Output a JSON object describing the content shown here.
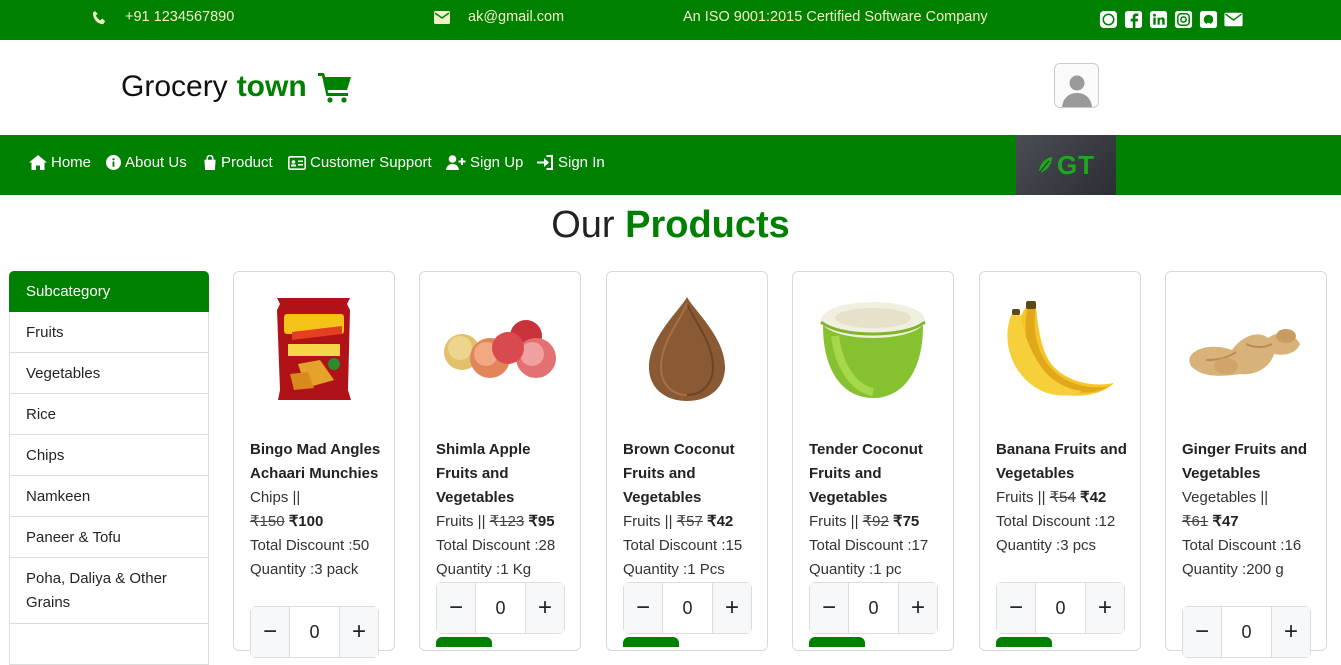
{
  "topbar": {
    "phone": "+91 1234567890",
    "email": "ak@gmail.com",
    "tagline": "An ISO 9001:2015 Certified Software Company",
    "social_icons": [
      "whatsapp-icon",
      "facebook-icon",
      "linkedin-icon",
      "instagram-icon",
      "github-icon",
      "mail-icon"
    ]
  },
  "brand": {
    "part1": "Grocery",
    "part2": "town",
    "accent": "#008000"
  },
  "nav": {
    "home": "Home",
    "about": "About Us",
    "product": "Product",
    "support": "Customer Support",
    "signup": "Sign Up",
    "signin": "Sign In",
    "logo_text": "GT"
  },
  "page": {
    "title_part1": "Our",
    "title_part2": "Products"
  },
  "sidebar": {
    "heading": "Subcategory",
    "items": [
      "Fruits",
      "Vegetables",
      "Rice",
      "Chips",
      "Namkeen",
      "Paneer & Tofu",
      "Poha, Daliya & Other Grains"
    ]
  },
  "products": [
    {
      "name": "Bingo Mad Angles Achaari Munchies",
      "category": "Chips ||",
      "mrp": "₹150",
      "price": "₹100",
      "discount": "Total Discount :50",
      "quantity": "Quantity :3 pack",
      "qty": "0"
    },
    {
      "name": "Shimla Apple Fruits and Vegetables",
      "category": "Fruits ||",
      "mrp": "₹123",
      "price": "₹95",
      "discount": "Total Discount :28",
      "quantity": "Quantity :1 Kg",
      "qty": "0"
    },
    {
      "name": "Brown Coconut Fruits and Vegetables",
      "category": "Fruits ||",
      "mrp": "₹57",
      "price": "₹42",
      "discount": "Total Discount :15",
      "quantity": "Quantity :1 Pcs",
      "qty": "0"
    },
    {
      "name": "Tender Coconut Fruits and Vegetables",
      "category": "Fruits ||",
      "mrp": "₹92",
      "price": "₹75",
      "discount": "Total Discount :17",
      "quantity": "Quantity :1 pc",
      "qty": "0"
    },
    {
      "name": "Banana Fruits and Vegetables",
      "category": "Fruits ||",
      "mrp": "₹54",
      "price": "₹42",
      "discount": "Total Discount :12",
      "quantity": "Quantity :3 pcs",
      "qty": "0"
    },
    {
      "name": "Ginger Fruits and Vegetables",
      "category": "Vegetables ||",
      "mrp": "₹61",
      "price": "₹47",
      "discount": "Total Discount :16",
      "quantity": "Quantity :200 g",
      "qty": "0"
    }
  ],
  "stepper": {
    "minus": "−",
    "plus": "+"
  }
}
